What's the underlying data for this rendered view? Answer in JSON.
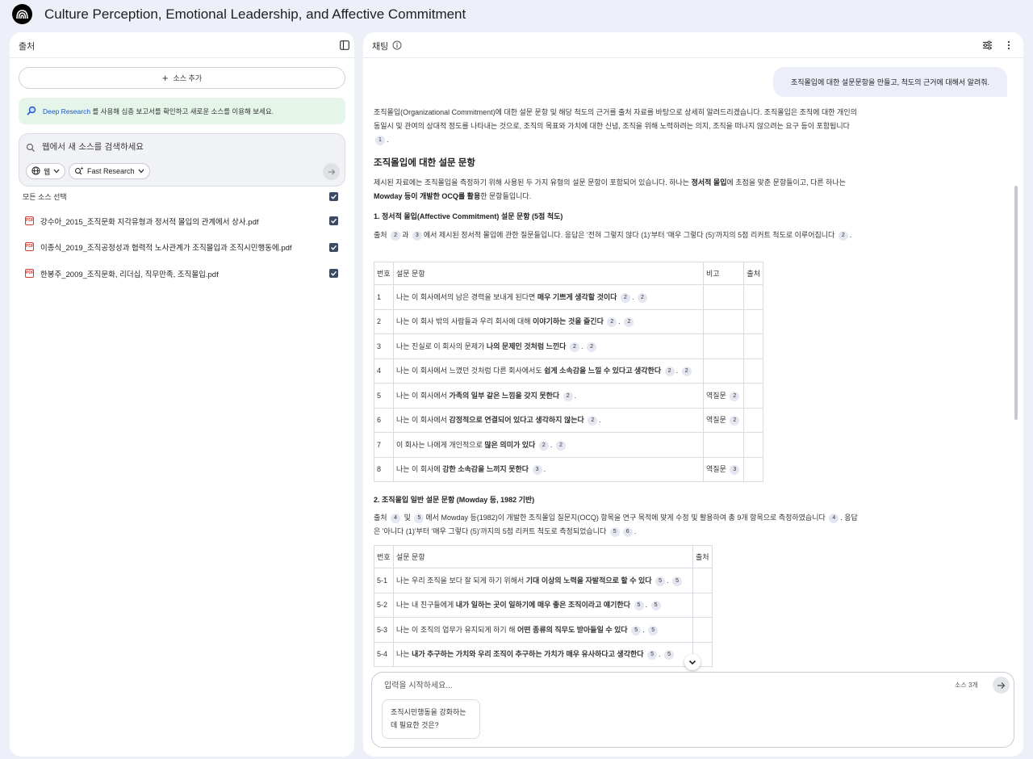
{
  "app": {
    "title": "Culture Perception, Emotional Leadership, and Affective Commitment"
  },
  "sources_panel": {
    "title": "출처",
    "add_source": "소스 추가",
    "deep_research": {
      "link": "Deep Research",
      "text": "를 사용해 심층 보고서를 확인하고 새로운 소스를 이용해 보세요."
    },
    "search": {
      "placeholder": "웹에서 새 소스를 검색하세요"
    },
    "web_chip": "웹",
    "research_chip": "Fast Research",
    "select_all": "모든 소스 선택",
    "sources": [
      {
        "label": "강수아_2015_조직문화 지각유형과 정서적 몰입의 관계에서 상사.pdf",
        "checked": true
      },
      {
        "label": "이종식_2019_조직공정성과 협력적 노사관계가 조직몰입과 조직시민행동에.pdf",
        "checked": true
      },
      {
        "label": "한봉주_2009_조직문화, 리더십, 직무만족, 조직몰입.pdf",
        "checked": true
      }
    ]
  },
  "chat_panel": {
    "title": "채팅",
    "user_message": "조직몰입에 대한 설문문항을 만들고, 척도의 근거에 대해서 알려줘.",
    "intro_text": "조직몰입(Organizational Commitment)에 대한 설문 문항 및 해당 척도의 근거를 출처 자료를 바탕으로 상세히 알려드리겠습니다. 조직몰입은 조직에 대한 개인의 동일시 및 관여의 상대적 정도를 나타내는 것으로, 조직의 목표와 가치에 대한 신념, 조직을 위해 노력하려는 의지, 조직을 떠나지 않으려는 요구 등이 포함됩니다",
    "section_title": "조직몰입에 대한 설문 문항",
    "section_p1": "제시된 자료에는 조직몰입을 측정하기 위해 사용된 두 가지 유형의 설문 문항이 포함되어 있습니다. 하나는",
    "section_p1_b1": "정서적 몰입",
    "section_p1_mid": "에 초점을 맞춘 문항들이고, 다른 하나는",
    "section_p1_b2": "Mowday 등이 개발한 OCQ를 활용",
    "section_p1_end": "한 문항들입니다.",
    "sub1_title": "1. 정서적 몰입(Affective Commitment) 설문 문항 (5점 척도)",
    "sub1_p_a": "출처",
    "sub1_p_b": "과",
    "sub1_p_c": "에서 제시된 정서적 몰입에 관한 질문들입니다. 응답은 '전혀 그렇지 않다 (1)'부터 '매우 그렇다 (5)'까지의 5점 리커트 척도로 이루어집니다",
    "table1": {
      "headers": [
        "번호",
        "설문 문항",
        "비고",
        "출처"
      ],
      "rows": [
        {
          "no": "1",
          "pre": "나는 이 회사에서의 남은 경력을 보내게 된다면",
          "bold": "매우 기쁘게 생각할 것이다",
          "post": "",
          "cites": [
            "2",
            "2"
          ],
          "note": "",
          "note_cite": ""
        },
        {
          "no": "2",
          "pre": "나는 이 회사 밖의 사람들과 우리 회사에 대해",
          "bold": "이야기하는 것을 즐긴다",
          "post": "",
          "cites": [
            "2",
            "2"
          ],
          "note": "",
          "note_cite": ""
        },
        {
          "no": "3",
          "pre": "나는 진실로 이 회사의 문제가",
          "bold": "나의 문제인 것처럼 느낀다",
          "post": "",
          "cites": [
            "2",
            "2"
          ],
          "note": "",
          "note_cite": ""
        },
        {
          "no": "4",
          "pre": "나는 이 회사에서 느꼈던 것처럼 다른 회사에서도",
          "bold": "쉽게 소속감을 느낄 수 있다고 생각한다",
          "post": "",
          "cites": [
            "2",
            "2"
          ],
          "note": "",
          "note_cite": ""
        },
        {
          "no": "5",
          "pre": "나는 이 회사에서",
          "bold": "가족의 일부 같은 느낌을 갖지 못한다",
          "post": "",
          "cites": [
            "2"
          ],
          "note": "역질문",
          "note_cite": "2"
        },
        {
          "no": "6",
          "pre": "나는 이 회사에서",
          "bold": "감정적으로 연결되어 있다고 생각하지 않는다",
          "post": "",
          "cites": [
            "2"
          ],
          "note": "역질문",
          "note_cite": "2"
        },
        {
          "no": "7",
          "pre": "이 회사는 나에게 개인적으로",
          "bold": "많은 의미가 있다",
          "post": "",
          "cites": [
            "2",
            "2"
          ],
          "note": "",
          "note_cite": ""
        },
        {
          "no": "8",
          "pre": "나는 이 회사에",
          "bold": "강한 소속감을 느끼지 못한다",
          "post": "",
          "cites": [
            "3"
          ],
          "note": "역질문",
          "note_cite": "3"
        }
      ]
    },
    "sub2_title": "2. 조직몰입 일반 설문 문항 (Mowday 등, 1982 기반)",
    "sub2_p_a": "출처",
    "sub2_p_b": "및",
    "sub2_p_c": "에서 Mowday 등(1982)이 개발한 조직몰입 질문지(OCQ) 항목을 연구 목적에 맞게 수정 및 활용하여 총 9개 항목으로 측정하였습니다",
    "sub2_p_d": "응답은 '아니다 (1)'부터 '매우 그렇다 (5)'까지의 5점 리커트 척도로 측정되었습니다",
    "table2": {
      "headers": [
        "번호",
        "설문 문항",
        "출처"
      ],
      "rows": [
        {
          "no": "5-1",
          "pre": "나는 우리 조직을 보다 잘 되게 하기 위해서",
          "bold": "기대 이상의 노력을 자발적으로 할 수 있다",
          "cites": [
            "5",
            "5"
          ]
        },
        {
          "no": "5-2",
          "pre": "나는 내 친구들에게",
          "bold": "내가 일하는 곳이 일하기에 매우 좋은 조직이라고 얘기한다",
          "cites": [
            "5",
            "5"
          ]
        },
        {
          "no": "5-3",
          "pre": "나는 이 조직의 업무가 유지되게 하기 해",
          "bold": "어떤 종류의 직무도 받아들일 수 있다",
          "cites": [
            "5",
            "5"
          ]
        },
        {
          "no": "5-4",
          "pre": "나는",
          "bold": "내가 추구하는 가치와 우리 조직이 추구하는 가치가 매우 유사하다고 생각한다",
          "cites": [
            "5",
            "5"
          ]
        }
      ]
    },
    "composer": {
      "placeholder": "입력을 시작하세요...",
      "source_count": "소스 3개",
      "suggestion": "조직시민행동을 강화하는 데 필요한 것은?"
    }
  },
  "colors": {
    "accent_link": "#1a56c8",
    "banner_bg": "#e6f5ea",
    "page_bg": "#eef0f9"
  }
}
